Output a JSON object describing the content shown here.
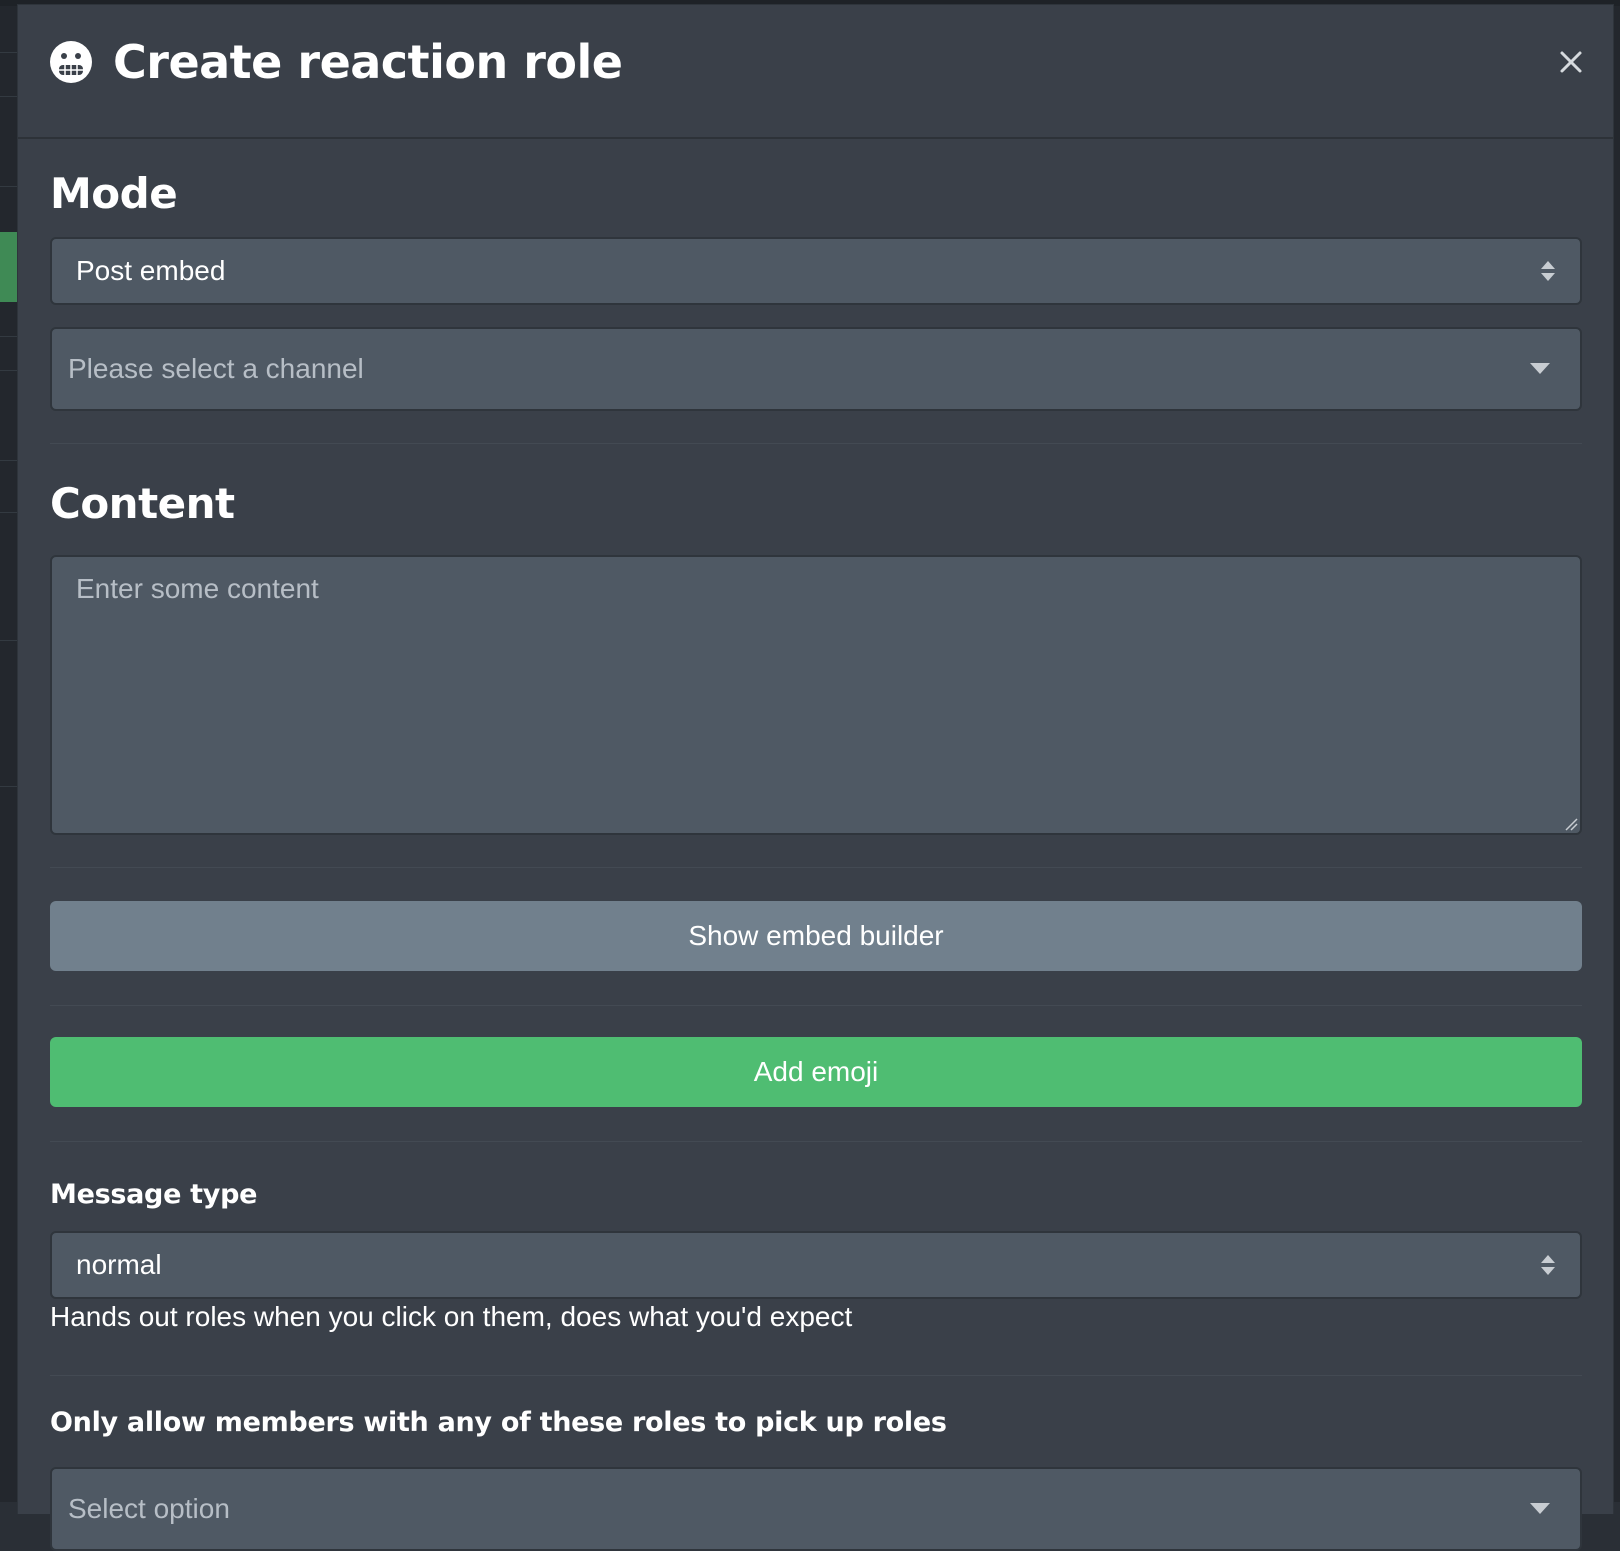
{
  "modal": {
    "title": "Create reaction role",
    "close_label": "×"
  },
  "mode": {
    "heading": "Mode",
    "selected": "Post embed",
    "channel_placeholder": "Please select a channel"
  },
  "content": {
    "heading": "Content",
    "placeholder": "Enter some content"
  },
  "buttons": {
    "show_embed_builder": "Show embed builder",
    "add_emoji": "Add emoji"
  },
  "message_type": {
    "heading": "Message type",
    "selected": "normal",
    "help": "Hands out roles when you click on them, does what you'd expect"
  },
  "allowed_roles": {
    "heading": "Only allow members with any of these roles to pick up roles",
    "placeholder": "Select option"
  },
  "colors": {
    "modal_bg": "#3a4049",
    "input_bg": "#4f5964",
    "secondary_button": "#71808d",
    "success_button": "#4fbd72"
  },
  "icons": {
    "header": "grimacing-face-icon",
    "close": "close-icon",
    "select_arrows": "sort-updown-icon",
    "dropdown": "caret-down-icon"
  }
}
